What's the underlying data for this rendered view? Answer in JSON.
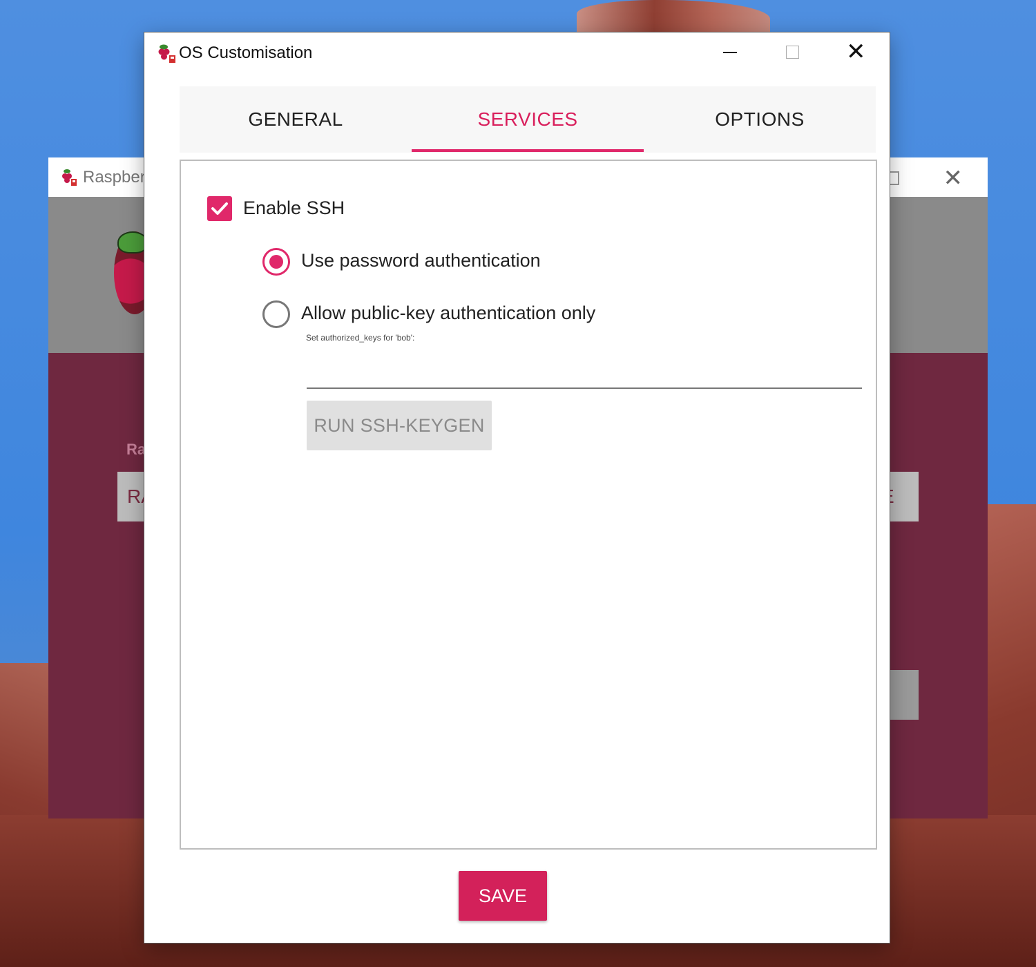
{
  "colors": {
    "accent": "#e0286a",
    "save": "#d3215a",
    "imager_bg": "#6f2840"
  },
  "background_window": {
    "title": "Raspberr",
    "label": "Ra",
    "button_left_text": "RA",
    "button_right_text": "E"
  },
  "dialog": {
    "title": "OS Customisation",
    "icon": "raspberry-pi-icon",
    "window_controls": [
      "minimize-icon",
      "maximize-icon",
      "close-icon"
    ]
  },
  "tabs": [
    {
      "label": "GENERAL",
      "selected": false
    },
    {
      "label": "SERVICES",
      "selected": true
    },
    {
      "label": "OPTIONS",
      "selected": false
    }
  ],
  "services": {
    "enable_ssh": {
      "label": "Enable SSH",
      "checked": true
    },
    "auth_options": [
      {
        "label": "Use password authentication",
        "selected": true
      },
      {
        "label": "Allow public-key authentication only",
        "selected": false
      }
    ],
    "authorized_keys": {
      "label": "Set authorized_keys for 'bob':",
      "value": ""
    },
    "keygen_button": "RUN SSH-KEYGEN"
  },
  "save_button": "SAVE"
}
